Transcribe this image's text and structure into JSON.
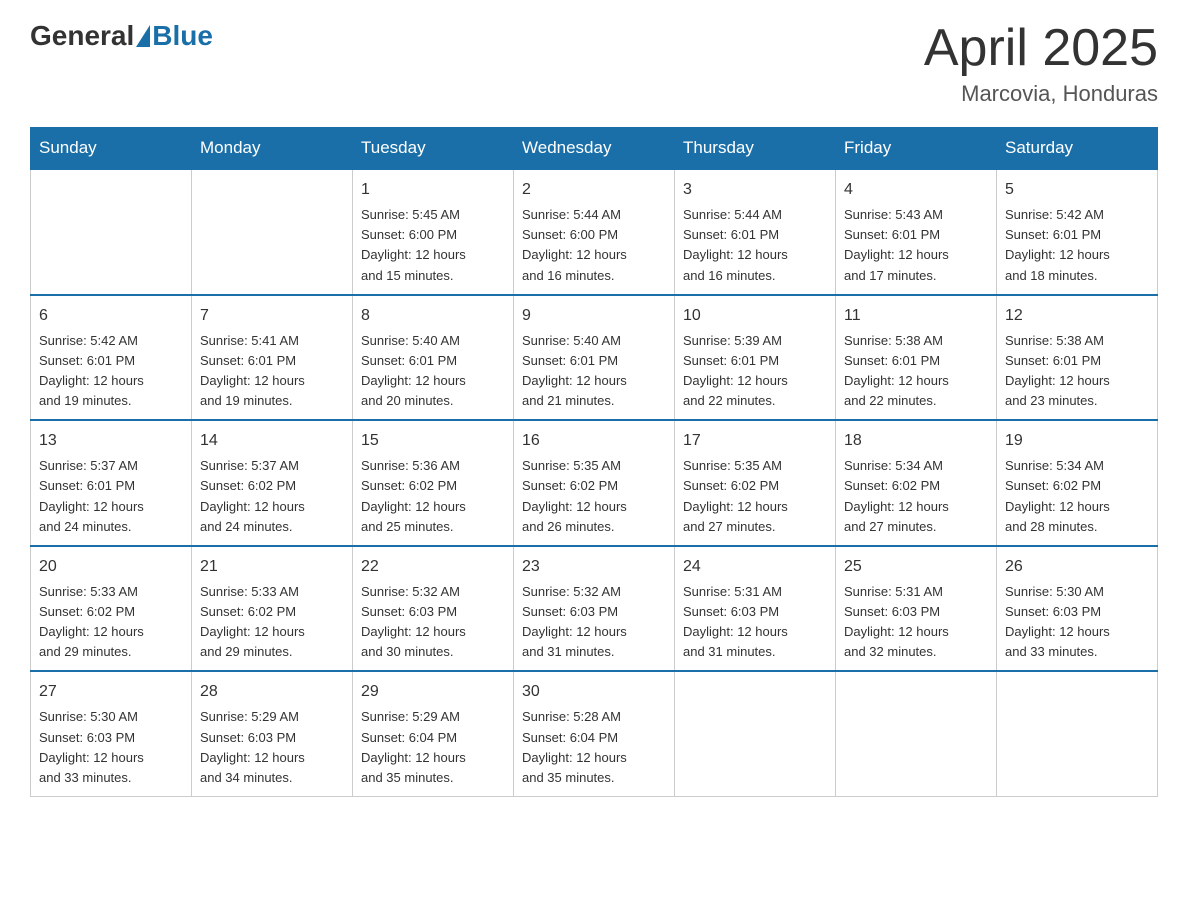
{
  "logo": {
    "general": "General",
    "blue": "Blue"
  },
  "title": "April 2025",
  "subtitle": "Marcovia, Honduras",
  "days_of_week": [
    "Sunday",
    "Monday",
    "Tuesday",
    "Wednesday",
    "Thursday",
    "Friday",
    "Saturday"
  ],
  "weeks": [
    [
      {
        "day": "",
        "info": ""
      },
      {
        "day": "",
        "info": ""
      },
      {
        "day": "1",
        "info": "Sunrise: 5:45 AM\nSunset: 6:00 PM\nDaylight: 12 hours\nand 15 minutes."
      },
      {
        "day": "2",
        "info": "Sunrise: 5:44 AM\nSunset: 6:00 PM\nDaylight: 12 hours\nand 16 minutes."
      },
      {
        "day": "3",
        "info": "Sunrise: 5:44 AM\nSunset: 6:01 PM\nDaylight: 12 hours\nand 16 minutes."
      },
      {
        "day": "4",
        "info": "Sunrise: 5:43 AM\nSunset: 6:01 PM\nDaylight: 12 hours\nand 17 minutes."
      },
      {
        "day": "5",
        "info": "Sunrise: 5:42 AM\nSunset: 6:01 PM\nDaylight: 12 hours\nand 18 minutes."
      }
    ],
    [
      {
        "day": "6",
        "info": "Sunrise: 5:42 AM\nSunset: 6:01 PM\nDaylight: 12 hours\nand 19 minutes."
      },
      {
        "day": "7",
        "info": "Sunrise: 5:41 AM\nSunset: 6:01 PM\nDaylight: 12 hours\nand 19 minutes."
      },
      {
        "day": "8",
        "info": "Sunrise: 5:40 AM\nSunset: 6:01 PM\nDaylight: 12 hours\nand 20 minutes."
      },
      {
        "day": "9",
        "info": "Sunrise: 5:40 AM\nSunset: 6:01 PM\nDaylight: 12 hours\nand 21 minutes."
      },
      {
        "day": "10",
        "info": "Sunrise: 5:39 AM\nSunset: 6:01 PM\nDaylight: 12 hours\nand 22 minutes."
      },
      {
        "day": "11",
        "info": "Sunrise: 5:38 AM\nSunset: 6:01 PM\nDaylight: 12 hours\nand 22 minutes."
      },
      {
        "day": "12",
        "info": "Sunrise: 5:38 AM\nSunset: 6:01 PM\nDaylight: 12 hours\nand 23 minutes."
      }
    ],
    [
      {
        "day": "13",
        "info": "Sunrise: 5:37 AM\nSunset: 6:01 PM\nDaylight: 12 hours\nand 24 minutes."
      },
      {
        "day": "14",
        "info": "Sunrise: 5:37 AM\nSunset: 6:02 PM\nDaylight: 12 hours\nand 24 minutes."
      },
      {
        "day": "15",
        "info": "Sunrise: 5:36 AM\nSunset: 6:02 PM\nDaylight: 12 hours\nand 25 minutes."
      },
      {
        "day": "16",
        "info": "Sunrise: 5:35 AM\nSunset: 6:02 PM\nDaylight: 12 hours\nand 26 minutes."
      },
      {
        "day": "17",
        "info": "Sunrise: 5:35 AM\nSunset: 6:02 PM\nDaylight: 12 hours\nand 27 minutes."
      },
      {
        "day": "18",
        "info": "Sunrise: 5:34 AM\nSunset: 6:02 PM\nDaylight: 12 hours\nand 27 minutes."
      },
      {
        "day": "19",
        "info": "Sunrise: 5:34 AM\nSunset: 6:02 PM\nDaylight: 12 hours\nand 28 minutes."
      }
    ],
    [
      {
        "day": "20",
        "info": "Sunrise: 5:33 AM\nSunset: 6:02 PM\nDaylight: 12 hours\nand 29 minutes."
      },
      {
        "day": "21",
        "info": "Sunrise: 5:33 AM\nSunset: 6:02 PM\nDaylight: 12 hours\nand 29 minutes."
      },
      {
        "day": "22",
        "info": "Sunrise: 5:32 AM\nSunset: 6:03 PM\nDaylight: 12 hours\nand 30 minutes."
      },
      {
        "day": "23",
        "info": "Sunrise: 5:32 AM\nSunset: 6:03 PM\nDaylight: 12 hours\nand 31 minutes."
      },
      {
        "day": "24",
        "info": "Sunrise: 5:31 AM\nSunset: 6:03 PM\nDaylight: 12 hours\nand 31 minutes."
      },
      {
        "day": "25",
        "info": "Sunrise: 5:31 AM\nSunset: 6:03 PM\nDaylight: 12 hours\nand 32 minutes."
      },
      {
        "day": "26",
        "info": "Sunrise: 5:30 AM\nSunset: 6:03 PM\nDaylight: 12 hours\nand 33 minutes."
      }
    ],
    [
      {
        "day": "27",
        "info": "Sunrise: 5:30 AM\nSunset: 6:03 PM\nDaylight: 12 hours\nand 33 minutes."
      },
      {
        "day": "28",
        "info": "Sunrise: 5:29 AM\nSunset: 6:03 PM\nDaylight: 12 hours\nand 34 minutes."
      },
      {
        "day": "29",
        "info": "Sunrise: 5:29 AM\nSunset: 6:04 PM\nDaylight: 12 hours\nand 35 minutes."
      },
      {
        "day": "30",
        "info": "Sunrise: 5:28 AM\nSunset: 6:04 PM\nDaylight: 12 hours\nand 35 minutes."
      },
      {
        "day": "",
        "info": ""
      },
      {
        "day": "",
        "info": ""
      },
      {
        "day": "",
        "info": ""
      }
    ]
  ]
}
